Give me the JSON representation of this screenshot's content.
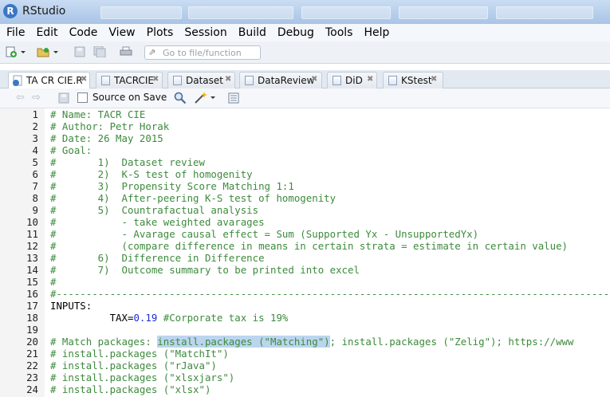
{
  "window": {
    "title": "RStudio"
  },
  "menu": [
    "File",
    "Edit",
    "Code",
    "View",
    "Plots",
    "Session",
    "Build",
    "Debug",
    "Tools",
    "Help"
  ],
  "toolbar": {
    "goto_placeholder": "Go to file/function"
  },
  "tabs": [
    {
      "label": "TA CR CIE.R",
      "active": true
    },
    {
      "label": "TACRCIE",
      "active": false
    },
    {
      "label": "Dataset",
      "active": false
    },
    {
      "label": "DataReview",
      "active": false
    },
    {
      "label": "DiD",
      "active": false
    },
    {
      "label": "KStest",
      "active": false
    }
  ],
  "editor_toolbar": {
    "source_on_save": "Source on Save"
  },
  "code_lines": [
    {
      "n": "1",
      "segs": [
        {
          "t": "# Name: TACR CIE",
          "c": "c"
        }
      ]
    },
    {
      "n": "2",
      "segs": [
        {
          "t": "# Author: Petr Horak",
          "c": "c"
        }
      ]
    },
    {
      "n": "3",
      "segs": [
        {
          "t": "# Date: 26 May 2015",
          "c": "c"
        }
      ]
    },
    {
      "n": "4",
      "segs": [
        {
          "t": "# Goal:",
          "c": "c"
        }
      ]
    },
    {
      "n": "5",
      "segs": [
        {
          "t": "#       1)  Dataset review",
          "c": "c"
        }
      ]
    },
    {
      "n": "6",
      "segs": [
        {
          "t": "#       2)  K-S test of homogenity",
          "c": "c"
        }
      ]
    },
    {
      "n": "7",
      "segs": [
        {
          "t": "#       3)  Propensity Score Matching 1:1",
          "c": "c"
        }
      ]
    },
    {
      "n": "8",
      "segs": [
        {
          "t": "#       4)  After-peering K-S test of homogenity",
          "c": "c"
        }
      ]
    },
    {
      "n": "9",
      "segs": [
        {
          "t": "#       5)  Countrafactual analysis",
          "c": "c"
        }
      ]
    },
    {
      "n": "10",
      "segs": [
        {
          "t": "#           - take weighted avarages",
          "c": "c"
        }
      ]
    },
    {
      "n": "11",
      "segs": [
        {
          "t": "#           - Avarage causal effect = Sum (Supported Yx - UnsupportedYx)",
          "c": "c"
        }
      ]
    },
    {
      "n": "12",
      "segs": [
        {
          "t": "#           (compare difference in means in certain strata = estimate in certain value)",
          "c": "c"
        }
      ]
    },
    {
      "n": "13",
      "segs": [
        {
          "t": "#       6)  Difference in Difference",
          "c": "c"
        }
      ]
    },
    {
      "n": "14",
      "segs": [
        {
          "t": "#       7)  Outcome summary to be printed into excel",
          "c": "c"
        }
      ]
    },
    {
      "n": "15",
      "segs": [
        {
          "t": "#",
          "c": "c"
        }
      ]
    },
    {
      "n": "16",
      "segs": [
        {
          "t": "#-----------------------------------------------------------------------------------------------",
          "c": "c"
        }
      ]
    },
    {
      "n": "17",
      "segs": [
        {
          "t": "INPUTS:",
          "c": "k"
        }
      ]
    },
    {
      "n": "18",
      "segs": [
        {
          "t": "          TAX=",
          "c": "k"
        },
        {
          "t": "0.19",
          "c": "num"
        },
        {
          "t": " #Corporate tax is 19%",
          "c": "c"
        }
      ]
    },
    {
      "n": "19",
      "segs": []
    },
    {
      "n": "20",
      "segs": [
        {
          "t": "# Match packages: ",
          "c": "c"
        },
        {
          "t": "install.packages (\"Matching\")",
          "c": "c hl"
        },
        {
          "t": "; install.packages (\"Zelig\"); https://www",
          "c": "c"
        }
      ]
    },
    {
      "n": "21",
      "segs": [
        {
          "t": "# install.packages (\"MatchIt\")",
          "c": "c"
        }
      ]
    },
    {
      "n": "22",
      "segs": [
        {
          "t": "# install.packages (\"rJava\")",
          "c": "c"
        }
      ]
    },
    {
      "n": "23",
      "segs": [
        {
          "t": "# install.packages (\"xlsxjars\")",
          "c": "c"
        }
      ]
    },
    {
      "n": "24",
      "segs": [
        {
          "t": "# install.packages (\"xlsx\")",
          "c": "c"
        }
      ]
    }
  ]
}
